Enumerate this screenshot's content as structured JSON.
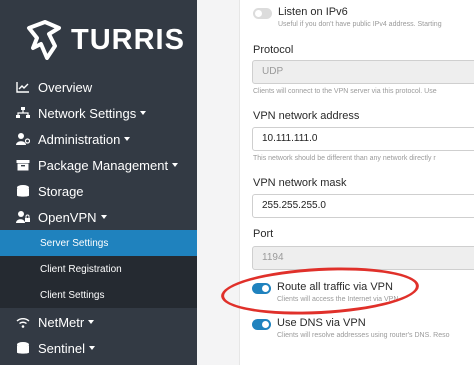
{
  "brand": {
    "name": "TURRIS"
  },
  "sidebar": {
    "items": [
      {
        "label": "Overview",
        "icon": "line-chart-icon"
      },
      {
        "label": "Network Settings",
        "icon": "network-icon",
        "dropdown": true
      },
      {
        "label": "Administration",
        "icon": "user-gear-icon",
        "dropdown": true
      },
      {
        "label": "Package Management",
        "icon": "box-icon",
        "dropdown": true
      },
      {
        "label": "Storage",
        "icon": "database-icon"
      },
      {
        "label": "OpenVPN",
        "icon": "user-lock-icon",
        "dropdown": true
      },
      {
        "label": "NetMetr",
        "icon": "wifi-icon",
        "dropdown": true
      },
      {
        "label": "Sentinel",
        "icon": "database-icon",
        "dropdown": true
      }
    ],
    "subitems": [
      {
        "label": "Server Settings",
        "active": true
      },
      {
        "label": "Client Registration",
        "active": false
      },
      {
        "label": "Client Settings",
        "active": false
      }
    ]
  },
  "form": {
    "ipv6": {
      "label": "Listen on IPv6",
      "help": "Useful if you don't have public IPv4 address. Starting",
      "on": false
    },
    "protocol": {
      "label": "Protocol",
      "value": "UDP",
      "help": "Clients will connect to the VPN server via this protocol. Use"
    },
    "network": {
      "label": "VPN network address",
      "value": "10.111.111.0",
      "help": "This network should be different than any network directly r"
    },
    "mask": {
      "label": "VPN network mask",
      "value": "255.255.255.0"
    },
    "port": {
      "label": "Port",
      "value": "1194"
    },
    "route": {
      "label": "Route all traffic via VPN",
      "help": "Clients will access the Internet via VPN",
      "on": true
    },
    "dns": {
      "label": "Use DNS via VPN",
      "help": "Clients will resolve addresses using router's DNS. Reso",
      "on": true
    }
  },
  "colors": {
    "sidebar_bg": "#333a44",
    "active": "#1f82be",
    "annotation": "#e0302a"
  }
}
